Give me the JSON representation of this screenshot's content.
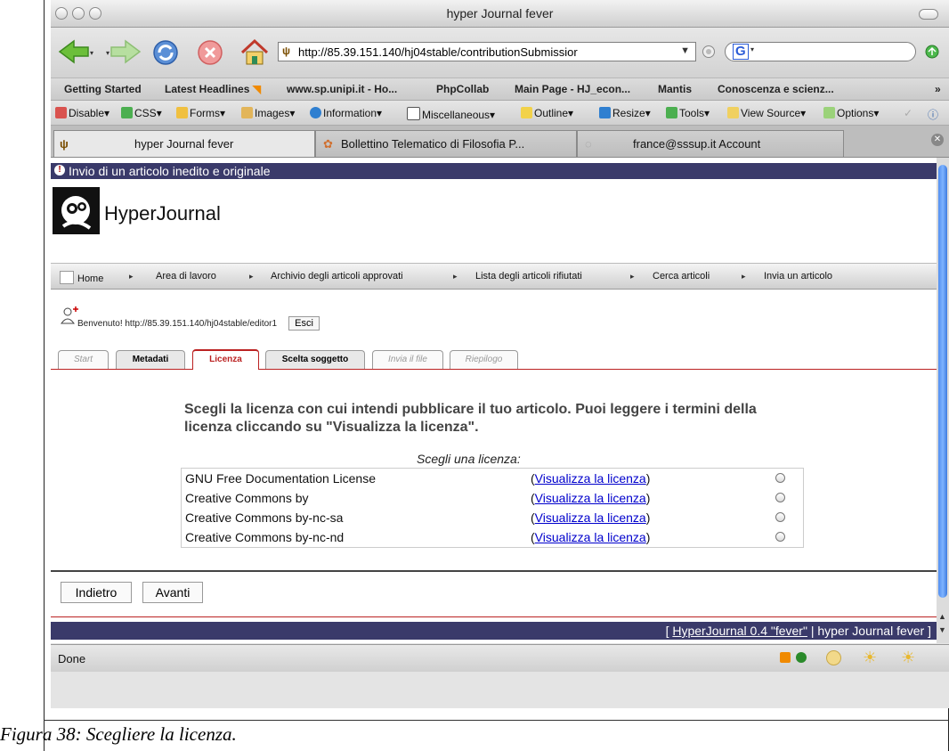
{
  "window": {
    "title": "hyper Journal fever"
  },
  "nav": {
    "url": "http://85.39.151.140/hj04stable/contributionSubmissior",
    "search_engine_glyph": "G"
  },
  "bookmarks": [
    "Getting Started",
    "Latest Headlines",
    "www.sp.unipi.it - Ho...",
    "PhpCollab",
    "Main Page - HJ_econ...",
    "Mantis",
    "Conoscenza e scienz..."
  ],
  "devtools": [
    "Disable",
    "CSS",
    "Forms",
    "Images",
    "Information",
    "Miscellaneous",
    "Outline",
    "Resize",
    "Tools",
    "View Source",
    "Options"
  ],
  "tabs": [
    {
      "label": "hyper Journal fever"
    },
    {
      "label": "Bollettino Telematico di Filosofia P..."
    },
    {
      "label": "france@sssup.it Account"
    }
  ],
  "page": {
    "header": "Invio di un articolo inedito e originale",
    "brand": "HyperJournal",
    "menu": [
      "Home",
      "Area di lavoro",
      "Archivio degli articoli approvati",
      "Lista degli articoli rifiutati",
      "Cerca articoli",
      "Invia un articolo"
    ],
    "welcome": "Benvenuto! http://85.39.151.140/hj04stable/editor1",
    "logout": "Esci",
    "steps": [
      "Start",
      "Metadati",
      "Licenza",
      "Scelta soggetto",
      "Invia il file",
      "Riepilogo"
    ],
    "prompt": "Scegli la licenza con cui intendi pubblicare il tuo articolo. Puoi leggere i termini della licenza cliccando su \"Visualizza la licenza\".",
    "choose_label": "Scegli una licenza:",
    "view_link": "Visualizza la licenza",
    "licenses": [
      "GNU Free Documentation License",
      "Creative Commons by",
      "Creative Commons by-nc-sa",
      "Creative Commons by-nc-nd"
    ],
    "back": "Indietro",
    "next": "Avanti",
    "footer_link": "HyperJournal 0.4 \"fever\"",
    "footer_site": "hyper Journal fever"
  },
  "status": {
    "text": "Done"
  },
  "caption": "Figura 38: Scegliere la licenza."
}
